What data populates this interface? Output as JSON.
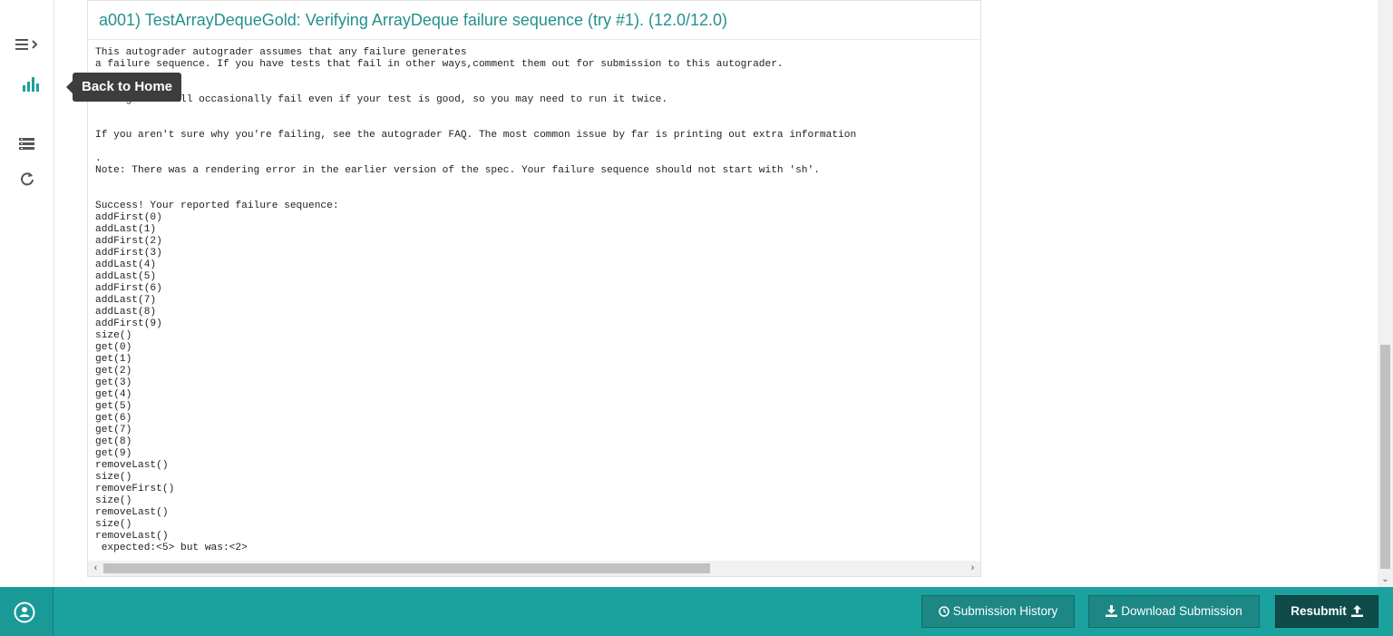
{
  "sidebar": {
    "tooltip": "Back to Home"
  },
  "card": {
    "title": "a001) TestArrayDequeGold: Verifying ArrayDeque failure sequence (try #1). (12.0/12.0)",
    "output": "This autograder autograder assumes that any failure generates\na failure sequence. If you have tests that fail in other ways,comment them out for submission to this autograder.\n\n\nThis grader will occasionally fail even if your test is good, so you may need to run it twice.\n\n\nIf you aren't sure why you're failing, see the autograder FAQ. The most common issue by far is printing out extra information\n\n.\nNote: There was a rendering error in the earlier version of the spec. Your failure sequence should not start with 'sh'.\n\n\nSuccess! Your reported failure sequence:\naddFirst(0)\naddLast(1)\naddFirst(2)\naddFirst(3)\naddLast(4)\naddLast(5)\naddFirst(6)\naddLast(7)\naddLast(8)\naddFirst(9)\nsize()\nget(0)\nget(1)\nget(2)\nget(3)\nget(4)\nget(5)\nget(6)\nget(7)\nget(8)\nget(9)\nremoveLast()\nsize()\nremoveFirst()\nsize()\nremoveLast()\nsize()\nremoveLast()\n expected:<5> but was:<2>"
  },
  "footer": {
    "submission_history": "Submission History",
    "download_submission": "Download Submission",
    "resubmit": "Resubmit"
  },
  "colors": {
    "accent": "#1ba19e",
    "title": "#24908f",
    "resubmit": "#0f4b4a",
    "tooltip": "#3d3d3d"
  }
}
